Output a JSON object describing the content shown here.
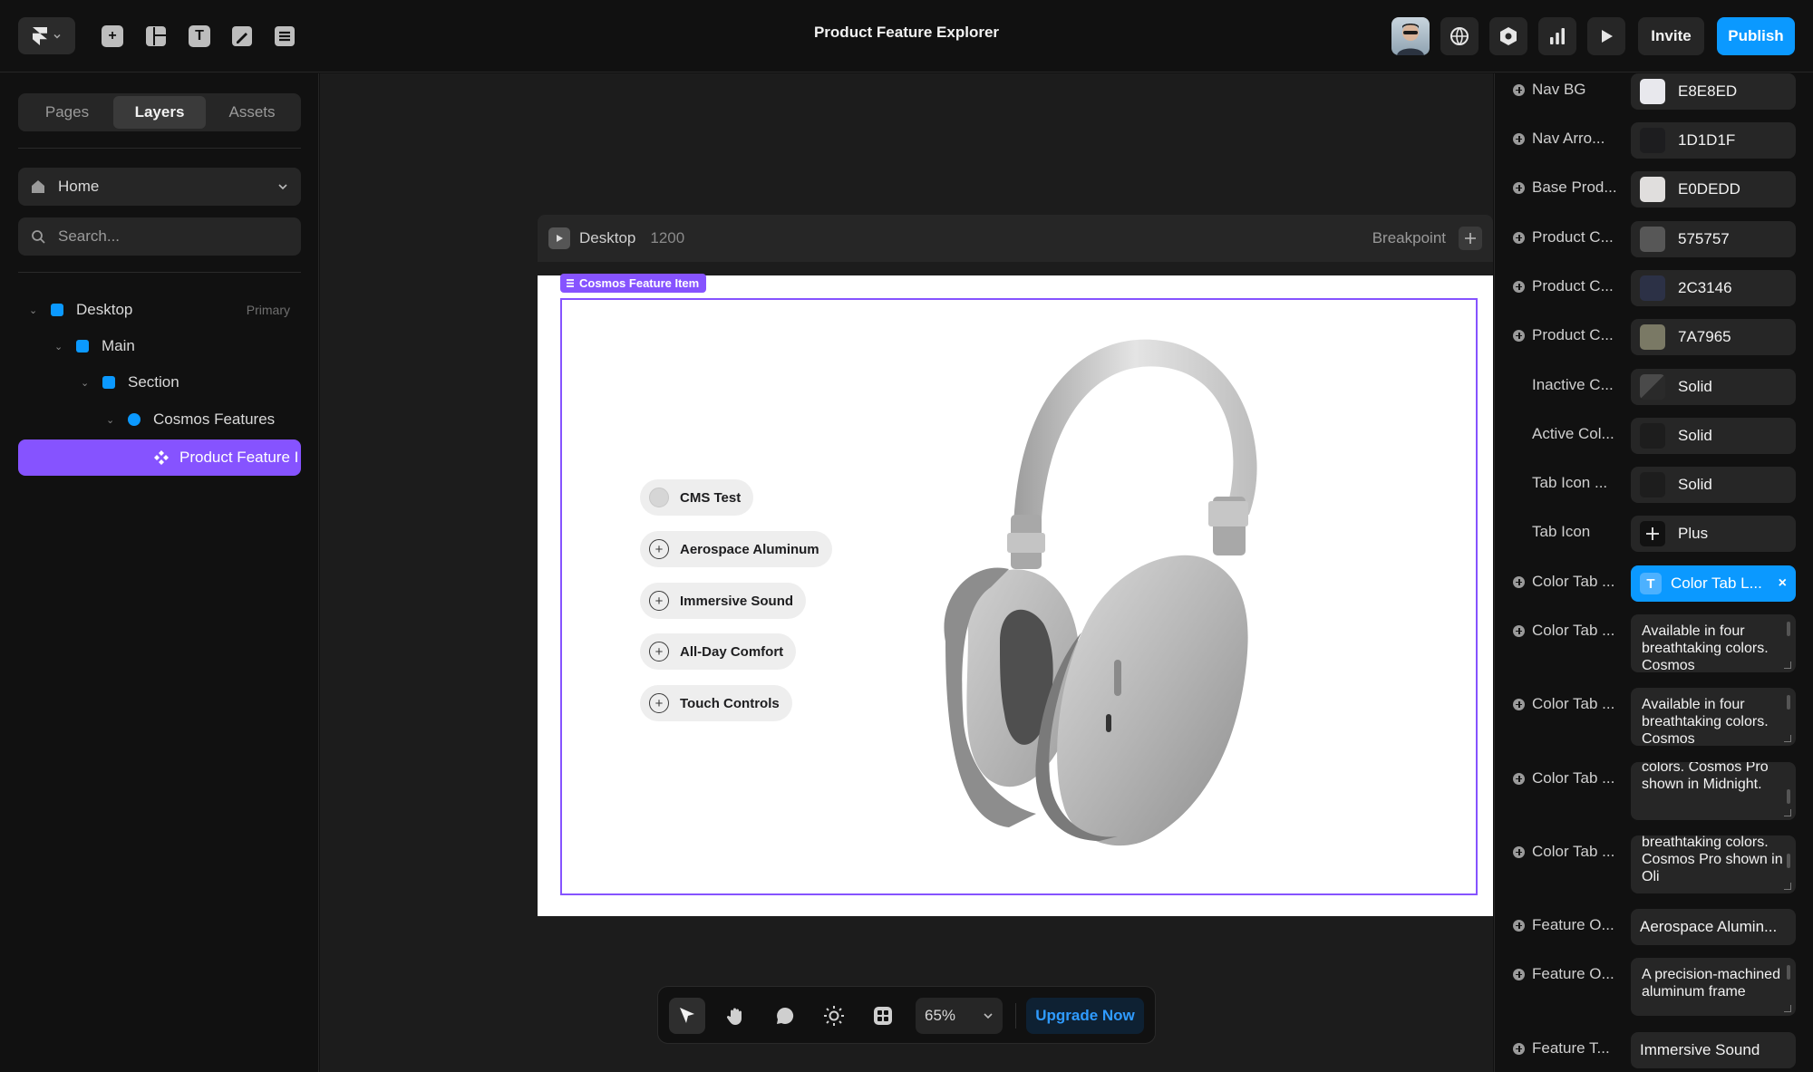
{
  "app": {
    "title": "Product Feature Explorer",
    "invite_label": "Invite",
    "publish_label": "Publish"
  },
  "left_panel": {
    "tabs": [
      {
        "label": "Pages",
        "active": false
      },
      {
        "label": "Layers",
        "active": true
      },
      {
        "label": "Assets",
        "active": false
      }
    ],
    "page_select": "Home",
    "search_placeholder": "Search...",
    "layers": [
      {
        "label": "Desktop",
        "tag": "Primary"
      },
      {
        "label": "Main"
      },
      {
        "label": "Section"
      },
      {
        "label": "Cosmos Features"
      },
      {
        "label": "Product Feature I"
      }
    ]
  },
  "canvas": {
    "frame_name": "Desktop",
    "frame_width": "1200",
    "breakpoint_label": "Breakpoint",
    "selection_tag": "Cosmos Feature Item",
    "features": [
      {
        "label": "CMS Test",
        "icon": "dot"
      },
      {
        "label": "Aerospace Aluminum",
        "icon": "plus"
      },
      {
        "label": "Immersive Sound",
        "icon": "plus"
      },
      {
        "label": "All-Day Comfort",
        "icon": "plus"
      },
      {
        "label": "Touch Controls",
        "icon": "plus"
      }
    ],
    "product_image": "headphones-silver"
  },
  "bottom_toolbar": {
    "zoom": "65%",
    "upgrade_label": "Upgrade Now"
  },
  "properties": [
    {
      "label": "Nav BG",
      "value": "E8E8ED",
      "swatch": "#E8E8ED"
    },
    {
      "label": "Nav Arro...",
      "value": "1D1D1F",
      "swatch": "#1D1D1F"
    },
    {
      "label": "Base Prod...",
      "value": "E0DEDD",
      "swatch": "#E0DEDD"
    },
    {
      "label": "Product C...",
      "value": "575757",
      "swatch": "#575757"
    },
    {
      "label": "Product C...",
      "value": "2C3146",
      "swatch": "#2C3146"
    },
    {
      "label": "Product C...",
      "value": "7A7965",
      "swatch": "#7A7965"
    },
    {
      "label": "Inactive C...",
      "value": "Solid",
      "swatch": "#3a3a3a"
    },
    {
      "label": "Active Col...",
      "value": "Solid",
      "swatch": "#1d1d1d"
    },
    {
      "label": "Tab Icon ...",
      "value": "Solid",
      "swatch": "#1d1d1d"
    },
    {
      "label": "Tab Icon",
      "value": "Plus",
      "icon": "plus"
    },
    {
      "label": "Color Tab ...",
      "value": "Color Tab L...",
      "linked": true
    },
    {
      "label": "Color Tab ...",
      "text": "Available in four breathtaking colors. Cosmos"
    },
    {
      "label": "Color Tab ...",
      "text": "Available in four breathtaking colors. Cosmos"
    },
    {
      "label": "Color Tab ...",
      "text": "colors. Cosmos Pro shown in Midnight."
    },
    {
      "label": "Color Tab ...",
      "text": "breathtaking colors. Cosmos Pro shown in Oli"
    },
    {
      "label": "Feature O...",
      "value": "Aerospace Alumin..."
    },
    {
      "label": "Feature O...",
      "text": "A precision-machined aluminum frame"
    },
    {
      "label": "Feature T...",
      "value": "Immersive Sound"
    }
  ]
}
